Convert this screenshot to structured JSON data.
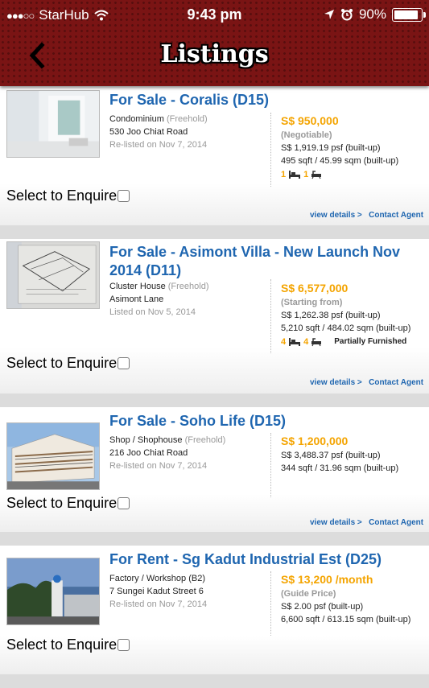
{
  "status_bar": {
    "carrier": "StarHub",
    "time": "9:43 pm",
    "battery": "90%",
    "battery_level": 0.9
  },
  "header": {
    "title": "Listings"
  },
  "enquire_label": "Select to Enquire",
  "view_details": "view details >",
  "contact_agent": "Contact Agent",
  "listings": [
    {
      "title": "For Sale - Coralis (D15)",
      "type": "Condominium",
      "tenure": "(Freehold)",
      "address": "530 Joo Chiat Road",
      "listed": "Re-listed on Nov 7, 2014",
      "price": "S$ 950,000",
      "price_note": "(Negotiable)",
      "psf": "S$ 1,919.19 psf (built-up)",
      "size": "495 sqft / 45.99 sqm (built-up)",
      "beds": "1",
      "baths": "1",
      "furnishing": ""
    },
    {
      "title": "For Sale - Asimont Villa - New Launch Nov 2014 (D11)",
      "type": "Cluster House",
      "tenure": "(Freehold)",
      "address": "Asimont Lane",
      "listed": "Listed on Nov 5, 2014",
      "price": "S$ 6,577,000",
      "price_note": "(Starting from)",
      "psf": "S$ 1,262.38 psf (built-up)",
      "size": "5,210 sqft / 484.02 sqm (built-up)",
      "beds": "4",
      "baths": "4",
      "furnishing": "Partially Furnished"
    },
    {
      "title": "For Sale - Soho Life (D15)",
      "type": "Shop / Shophouse",
      "tenure": "(Freehold)",
      "address": "216 Joo Chiat Road",
      "listed": "Re-listed on Nov 7, 2014",
      "price": "S$ 1,200,000",
      "price_note": "",
      "psf": "S$ 3,488.37 psf (built-up)",
      "size": "344 sqft / 31.96 sqm (built-up)",
      "beds": "",
      "baths": "",
      "furnishing": ""
    },
    {
      "title": "For Rent - Sg Kadut Industrial Est (D25)",
      "type": "Factory / Workshop (B2)",
      "tenure": "",
      "address": "7 Sungei Kadut Street 6",
      "listed": "Re-listed on Nov 7, 2014",
      "price": "S$ 13,200 /month",
      "price_note": "(Guide Price)",
      "psf": "S$ 2.00 psf (built-up)",
      "size": "6,600 sqft / 613.15 sqm (built-up)",
      "beds": "",
      "baths": "",
      "furnishing": ""
    }
  ]
}
